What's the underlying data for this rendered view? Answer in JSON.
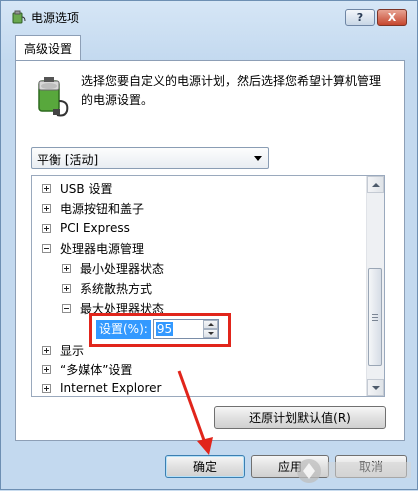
{
  "window": {
    "title": "电源选项",
    "help_glyph": "?",
    "close_glyph": "X"
  },
  "tab": {
    "label": "高级设置"
  },
  "description": {
    "line1": "选择您要自定义的电源计划，然后选择您希望计算机管理",
    "line2": "的电源设置。"
  },
  "plan_select": {
    "value": "平衡 [活动]"
  },
  "tree": {
    "items": [
      {
        "label": "USB 设置",
        "state": "plus"
      },
      {
        "label": "电源按钮和盖子",
        "state": "plus"
      },
      {
        "label": "PCI Express",
        "state": "plus"
      },
      {
        "label": "处理器电源管理",
        "state": "minus"
      },
      {
        "label": "最小处理器状态",
        "state": "plus"
      },
      {
        "label": "系统散热方式",
        "state": "plus"
      },
      {
        "label": "最大处理器状态",
        "state": "minus"
      },
      {
        "label": "显示",
        "state": "plus"
      },
      {
        "label": "“多媒体”设置",
        "state": "plus"
      },
      {
        "label": "Internet Explorer",
        "state": "plus"
      }
    ],
    "setting_label": "设置(%):",
    "setting_value": "95"
  },
  "buttons": {
    "restore": "还原计划默认值(R)",
    "ok": "确定",
    "apply": "应用",
    "cancel": "取消"
  },
  "colors": {
    "highlight_box": "#e1251b",
    "selection": "#3399ff"
  }
}
